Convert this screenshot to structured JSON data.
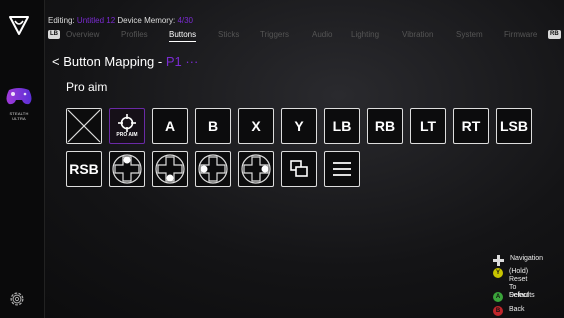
{
  "sidebar": {
    "device_label_line1": "STEALTH",
    "device_label_line2": "ULTRA"
  },
  "header": {
    "editing_label": "Editing:",
    "editing_value": "Untitled 12",
    "memory_label": "Device Memory:",
    "memory_value": "4/30"
  },
  "tabs": {
    "lb": "LB",
    "rb": "RB",
    "items": [
      "Overview",
      "Profiles",
      "Buttons",
      "Sticks",
      "Triggers",
      "Audio",
      "Lighting",
      "Vibration",
      "System",
      "Firmware"
    ],
    "active": "Buttons"
  },
  "page": {
    "back_glyph": "<",
    "title": "Button Mapping - ",
    "title_suffix": "P1 ···",
    "subtitle": "Pro aim"
  },
  "buttons": {
    "row1": [
      "",
      "PRO AIM",
      "A",
      "B",
      "X",
      "Y",
      "LB",
      "RB",
      "LT",
      "RT",
      "LSB"
    ],
    "row2": [
      "RSB",
      "",
      "",
      "",
      "",
      "",
      ""
    ]
  },
  "legend": {
    "navigation": "Navigation",
    "reset_key": "Y",
    "reset_line1": "(Hold) Reset",
    "reset_line2": "To Defaults",
    "select_key": "A",
    "select": "Select",
    "back_key": "B",
    "back": "Back"
  },
  "colors": {
    "accent": "#7a2bd1",
    "key_y": "#c8c400",
    "key_a": "#3aa43a",
    "key_b": "#c0262b"
  }
}
